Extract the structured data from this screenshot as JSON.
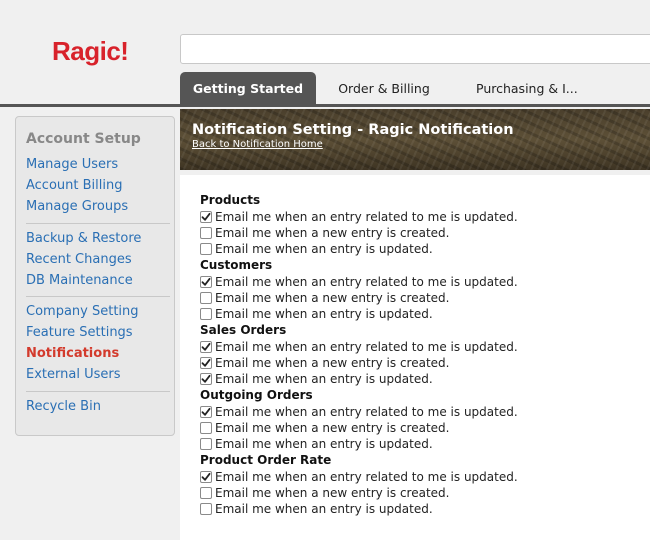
{
  "brand": {
    "logo": "Ragic!"
  },
  "tabs": [
    {
      "label": "Getting Started",
      "active": true
    },
    {
      "label": "Order & Billing",
      "active": false
    },
    {
      "label": "Purchasing & I...",
      "active": false
    }
  ],
  "sidebar": {
    "title": "Account Setup",
    "items": [
      {
        "label": "Manage Users"
      },
      {
        "label": "Account Billing"
      },
      {
        "label": "Manage Groups"
      },
      {
        "label": "Backup & Restore"
      },
      {
        "label": "Recent Changes"
      },
      {
        "label": "DB Maintenance"
      },
      {
        "label": "Company Setting"
      },
      {
        "label": "Feature Settings"
      },
      {
        "label": "Notifications",
        "active": true
      },
      {
        "label": "External Users"
      },
      {
        "label": "Recycle Bin"
      }
    ]
  },
  "banner": {
    "title": "Notification Setting - Ragic Notification",
    "back_link": "Back to Notification Home"
  },
  "sections": [
    {
      "title": "Products",
      "options": [
        {
          "label": "Email me when an entry related to me is updated.",
          "checked": true
        },
        {
          "label": "Email me when a new entry is created.",
          "checked": false
        },
        {
          "label": "Email me when an entry is updated.",
          "checked": false
        }
      ]
    },
    {
      "title": "Customers",
      "options": [
        {
          "label": "Email me when an entry related to me is updated.",
          "checked": true
        },
        {
          "label": "Email me when a new entry is created.",
          "checked": false
        },
        {
          "label": "Email me when an entry is updated.",
          "checked": false
        }
      ]
    },
    {
      "title": "Sales Orders",
      "options": [
        {
          "label": "Email me when an entry related to me is updated.",
          "checked": true
        },
        {
          "label": "Email me when a new entry is created.",
          "checked": true
        },
        {
          "label": "Email me when an entry is updated.",
          "checked": true
        }
      ]
    },
    {
      "title": "Outgoing Orders",
      "options": [
        {
          "label": "Email me when an entry related to me is updated.",
          "checked": true
        },
        {
          "label": "Email me when a new entry is created.",
          "checked": false
        },
        {
          "label": "Email me when an entry is updated.",
          "checked": false
        }
      ]
    },
    {
      "title": "Product Order Rate",
      "options": [
        {
          "label": "Email me when an entry related to me is updated.",
          "checked": true
        },
        {
          "label": "Email me when a new entry is created.",
          "checked": false
        },
        {
          "label": "Email me when an entry is updated.",
          "checked": false
        }
      ]
    }
  ],
  "colors": {
    "brand": "#d8222b",
    "link": "#2a6fb4",
    "active_nav": "#d33a2c",
    "tab_active": "#555555"
  }
}
